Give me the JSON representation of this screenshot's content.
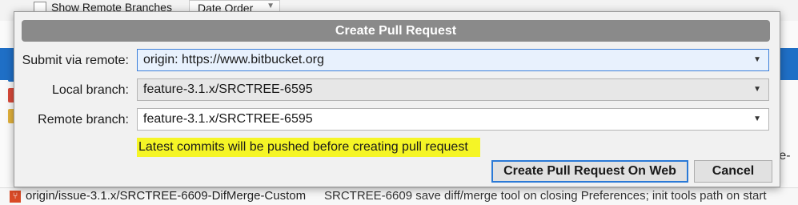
{
  "background": {
    "toolbar": {
      "show_remote_branches_label": "Show Remote Branches",
      "order_dropdown_value": "Date Order"
    },
    "bottom_row": {
      "branch_text": "origin/issue-3.1.x/SRCTREE-6609-DifMerge-Custom",
      "commit_message": "SRCTREE-6609 save diff/merge tool on closing Preferences; init tools path on start"
    },
    "right_edge_text": "ate-E"
  },
  "dialog": {
    "title": "Create Pull Request",
    "submit_remote": {
      "label": "Submit via remote:",
      "value": "origin: https://www.bitbucket.org"
    },
    "local_branch": {
      "label": "Local branch:",
      "value": "feature-3.1.x/SRCTREE-6595"
    },
    "remote_branch": {
      "label": "Remote branch:",
      "value": "feature-3.1.x/SRCTREE-6595"
    },
    "notice": "Latest commits will be pushed before creating pull request",
    "buttons": {
      "create_on_web": "Create Pull Request On Web",
      "cancel": "Cancel"
    }
  },
  "colors": {
    "notice_highlight": "#f5f526",
    "focus_border": "#3d7fd9",
    "titlebar": "#8a8a8a",
    "accent_blue": "#1f6fc6"
  }
}
